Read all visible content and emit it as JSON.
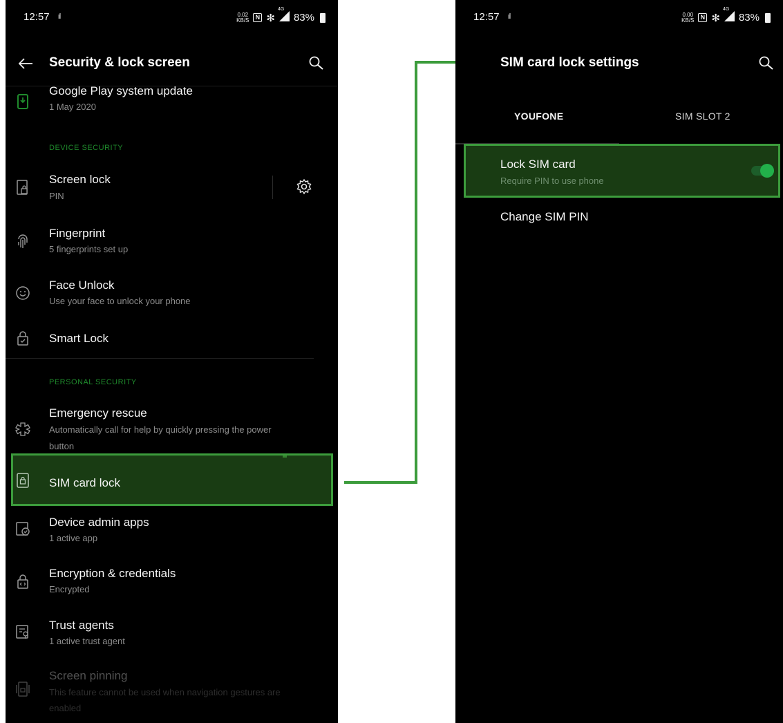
{
  "left": {
    "status": {
      "time": "12:57",
      "signal_glyph": "ıl",
      "speed_top": "0.02",
      "speed_bottom": "KB/S",
      "nfc": "N",
      "bluetooth": "✻",
      "network": "4G",
      "battery": "83%"
    },
    "toolbar": {
      "title": "Security & lock screen"
    },
    "items": {
      "google_play": {
        "title": "Google Play system update",
        "sub": "1 May 2020"
      },
      "device_security_header": "DEVICE SECURITY",
      "screen_lock": {
        "title": "Screen lock",
        "sub": "PIN"
      },
      "fingerprint": {
        "title": "Fingerprint",
        "sub": "5 fingerprints set up"
      },
      "face_unlock": {
        "title": "Face Unlock",
        "sub": "Use your face to unlock your phone"
      },
      "smart_lock": {
        "title": "Smart Lock"
      },
      "personal_security_header": "PERSONAL SECURITY",
      "emergency_rescue": {
        "title": "Emergency rescue",
        "sub1": "Automatically call for help by quickly pressing the power",
        "sub2": "button"
      },
      "sim_card_lock": {
        "title": "SIM card lock"
      },
      "device_admin": {
        "title": "Device admin apps",
        "sub": "1 active app"
      },
      "encryption": {
        "title": "Encryption & credentials",
        "sub": "Encrypted"
      },
      "trust_agents": {
        "title": "Trust agents",
        "sub": "1 active trust agent"
      },
      "screen_pinning": {
        "title": "Screen pinning",
        "sub1": "This feature cannot be used when navigation gestures are",
        "sub2": "enabled"
      }
    }
  },
  "right": {
    "status": {
      "time": "12:57",
      "signal_glyph": "ıl",
      "speed_top": "0.00",
      "speed_bottom": "KB/S",
      "nfc": "N",
      "bluetooth": "✻",
      "network": "4G",
      "battery": "83%"
    },
    "toolbar": {
      "title": "SIM card lock settings"
    },
    "tabs": {
      "tab1": "YOUFONE",
      "tab2": "SIM SLOT 2"
    },
    "items": {
      "lock_sim": {
        "title": "Lock SIM card",
        "sub": "Require PIN to use phone",
        "toggle_on": true
      },
      "change_pin": {
        "title": "Change SIM PIN"
      }
    }
  },
  "colors": {
    "accent_green": "#3c9c3c",
    "toggle_green": "#22b04a",
    "section_green": "#1f8a2c",
    "background": "#000000"
  },
  "icons": [
    "back-arrow-icon",
    "search-icon",
    "system-update-icon",
    "screen-lock-icon",
    "gear-icon",
    "fingerprint-icon",
    "face-icon",
    "smart-lock-icon",
    "emergency-icon",
    "sim-lock-icon",
    "device-admin-icon",
    "encryption-icon",
    "trust-agent-icon",
    "screen-pinning-icon"
  ]
}
